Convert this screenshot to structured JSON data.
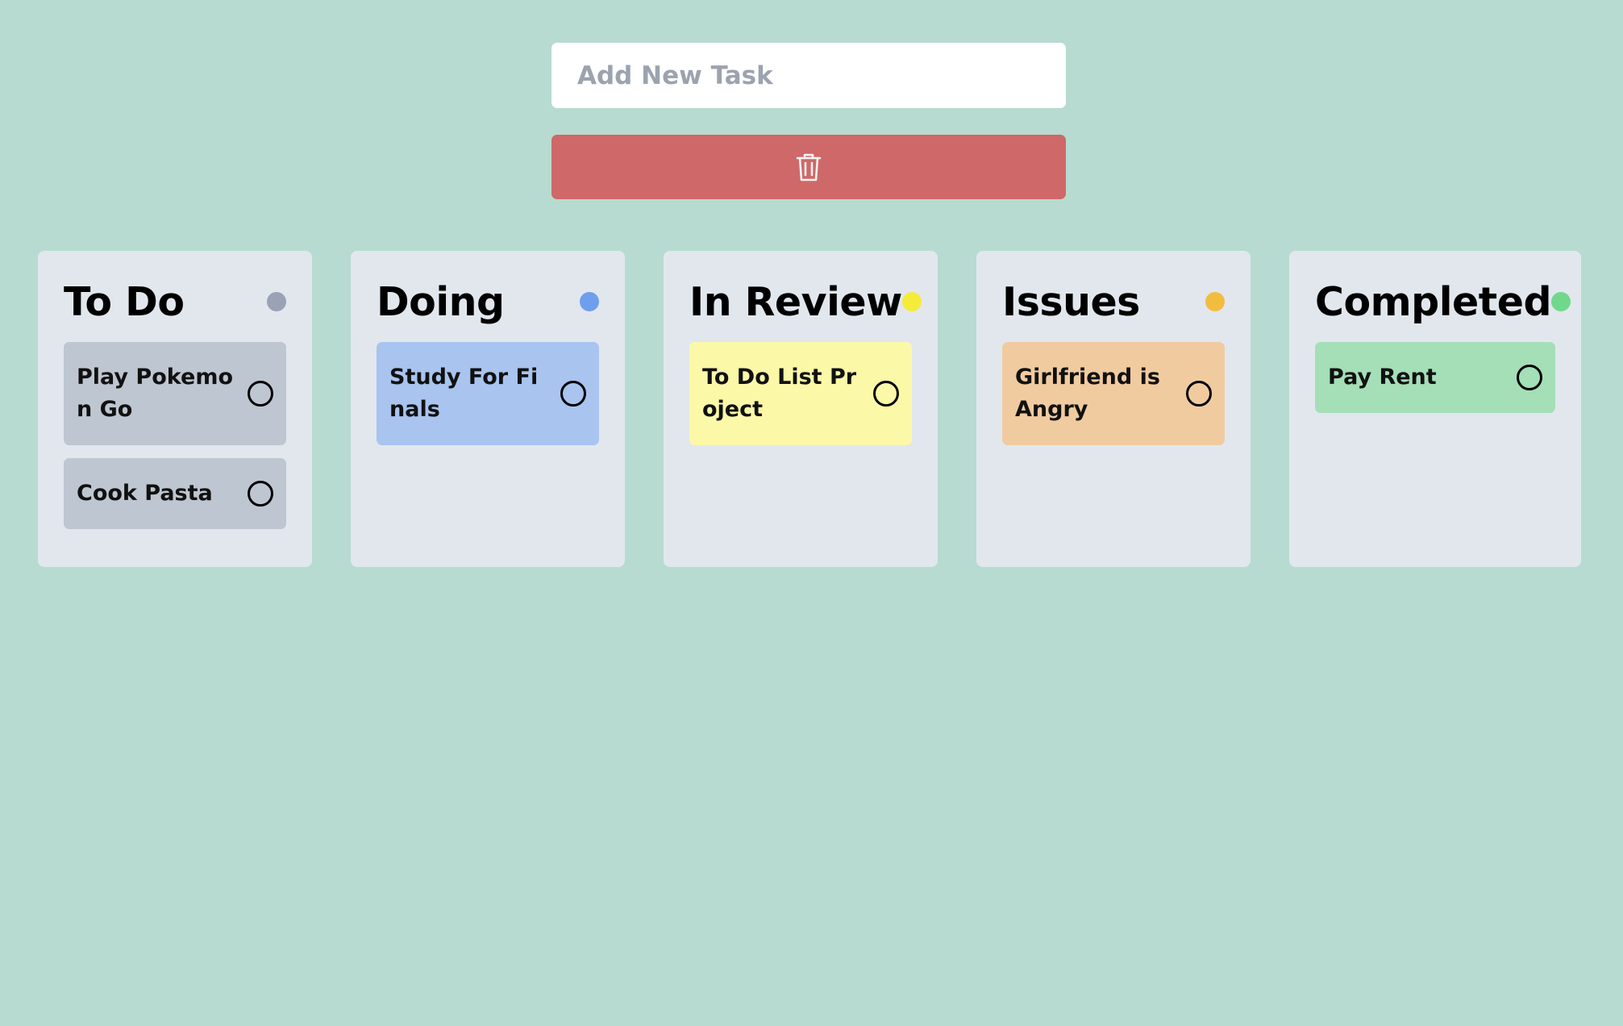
{
  "new_task": {
    "placeholder": "Add New Task",
    "value": ""
  },
  "delete_button": {
    "icon": "trash-icon",
    "color": "#cf6868"
  },
  "columns": [
    {
      "title": "To Do",
      "dot_color": "#9aa3b5",
      "card_color": "#bec6d1",
      "tasks": [
        "Play Pokemon Go",
        "Cook Pasta"
      ]
    },
    {
      "title": "Doing",
      "dot_color": "#6f9fec",
      "card_color": "#a8c4ef",
      "tasks": [
        "Study For Finals"
      ]
    },
    {
      "title": "In Review",
      "dot_color": "#f5ec3a",
      "card_color": "#fbf8a8",
      "tasks": [
        "To Do List Project"
      ]
    },
    {
      "title": "Issues",
      "dot_color": "#f1bd3f",
      "card_color": "#f1cba0",
      "tasks": [
        "Girlfriend is Angry"
      ]
    },
    {
      "title": "Completed",
      "dot_color": "#6fd88c",
      "card_color": "#a4dfb8",
      "tasks": [
        "Pay Rent"
      ]
    }
  ]
}
